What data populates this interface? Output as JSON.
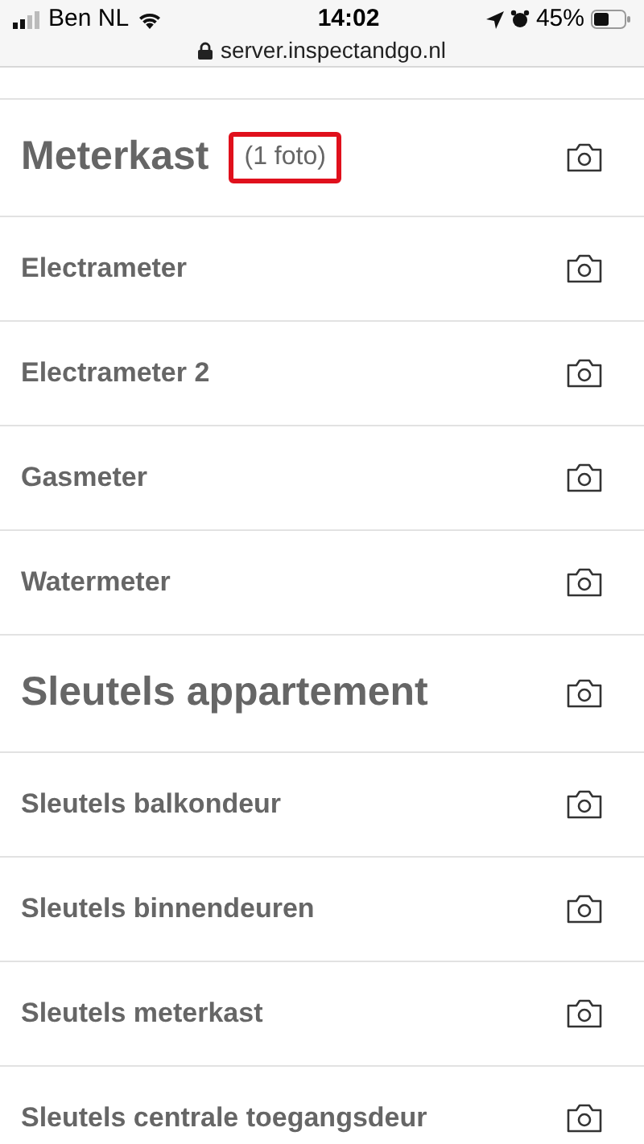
{
  "status_bar": {
    "carrier": "Ben NL",
    "time": "14:02",
    "battery": "45%",
    "url": "server.inspectandgo.nl"
  },
  "rows": [
    {
      "kind": "section",
      "label": "Meterkast",
      "count": "(1 foto)",
      "highlighted": true
    },
    {
      "kind": "item",
      "label": "Electrameter"
    },
    {
      "kind": "item",
      "label": "Electrameter 2"
    },
    {
      "kind": "item",
      "label": "Gasmeter"
    },
    {
      "kind": "item",
      "label": "Watermeter"
    },
    {
      "kind": "section",
      "label": "Sleutels appartement"
    },
    {
      "kind": "item",
      "label": "Sleutels balkondeur"
    },
    {
      "kind": "item",
      "label": "Sleutels binnendeuren"
    },
    {
      "kind": "item",
      "label": "Sleutels meterkast"
    },
    {
      "kind": "item",
      "label": "Sleutels centrale toegangsdeur"
    }
  ]
}
